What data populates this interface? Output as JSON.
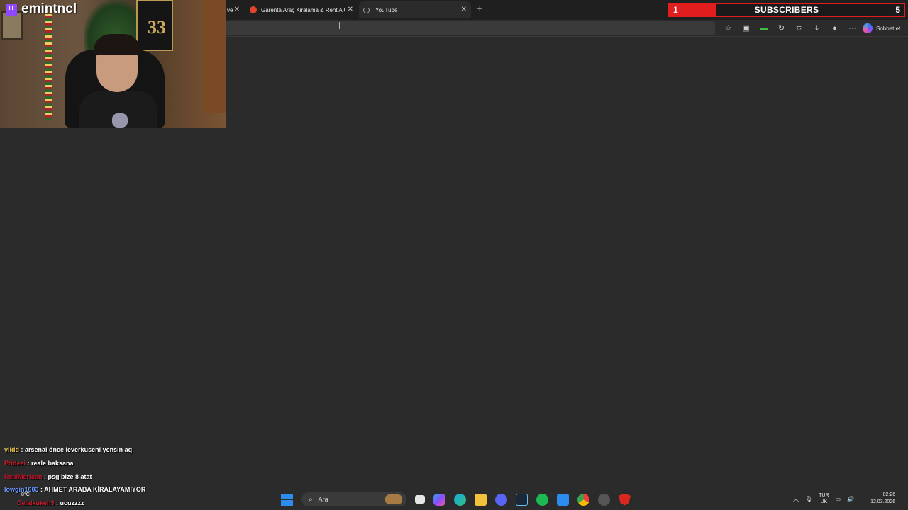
{
  "browser": {
    "tabs": [
      {
        "label": "ve"
      },
      {
        "label": "Garenta Araç Kiralama & Rent A C"
      },
      {
        "label": "YouTube",
        "loading": true
      }
    ],
    "new_tab": "+",
    "window_controls": [
      "—",
      "❐",
      "✕"
    ],
    "toolbar": {
      "chat_label": "Sohbet et",
      "icons": [
        "star-icon",
        "extension-icon",
        "battery-icon",
        "refresh-icon",
        "favorites-icon",
        "download-icon",
        "profile-icon",
        "more-icon"
      ]
    }
  },
  "overlay": {
    "streamer_name": "emintncl",
    "subscribers": {
      "current": "1",
      "label": "SUBSCRIBERS",
      "goal": "5",
      "progress": 0.2,
      "color": "#e21d1d"
    },
    "jersey_number": "33"
  },
  "chat": [
    {
      "user": "yiidd",
      "message": " : arsenal önce leverkuseni yensin aq",
      "color": "#f0c850"
    },
    {
      "user": "Prideei",
      "message": " : reale baksana",
      "color": "#d01a2a"
    },
    {
      "user": "RealMertcan",
      "message": " : psg bize 8 atat",
      "color": "#c0142a"
    },
    {
      "user": "lowgin1003",
      "message": " : AHMET ARABA KİRALAYAMIYOR",
      "color": "#6a9cff"
    },
    {
      "user": "Celalkukeh3",
      "message": " : ucuzzzz",
      "color": "#d01a2a"
    }
  ],
  "weather": "8°C",
  "taskbar": {
    "search_placeholder": "Ara",
    "apps": [
      "task-view-icon",
      "copilot-icon",
      "edge-icon",
      "file-explorer-icon",
      "discord-icon",
      "steam-icon",
      "spotify-icon",
      "store-icon",
      "chrome-icon",
      "settings-icon",
      "shield-icon"
    ],
    "tray": {
      "lang_top": "TUR",
      "lang_bottom": "UK",
      "time": "02:26",
      "date": "12.03.2026"
    }
  }
}
